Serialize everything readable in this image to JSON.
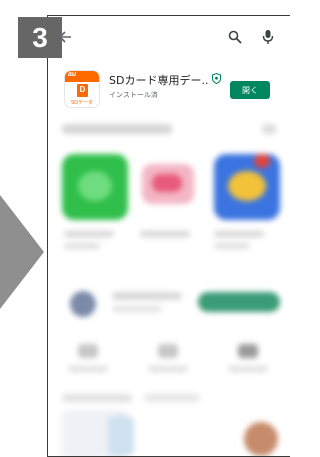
{
  "step": {
    "number": "3"
  },
  "app": {
    "name": "SDカード専用デー..",
    "status": "インストール済",
    "open_label": "開く",
    "icon": {
      "brand": "au",
      "card_letter": "D",
      "caption": "SDデータ"
    }
  },
  "icons": {
    "back": "arrow-left-icon",
    "search": "search-icon",
    "mic": "mic-icon",
    "shield": "shield-icon"
  },
  "colors": {
    "badge": "#666666",
    "arrow": "#8f8f8f",
    "open_button": "#01875f",
    "brand_orange": "#ff6a00"
  }
}
